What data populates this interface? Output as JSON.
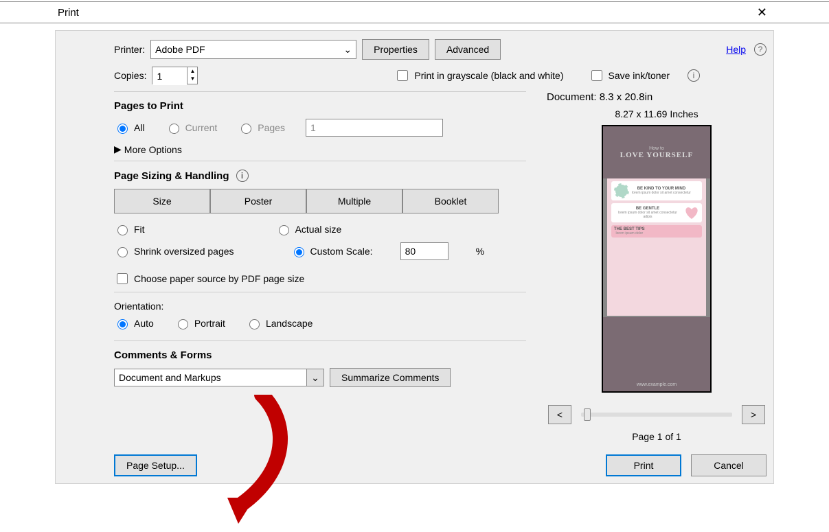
{
  "title": "Print",
  "printer": {
    "label": "Printer:",
    "selected": "Adobe PDF",
    "properties_btn": "Properties",
    "advanced_btn": "Advanced"
  },
  "help_link": "Help",
  "copies": {
    "label": "Copies:",
    "value": "1"
  },
  "grayscale_label": "Print in grayscale (black and white)",
  "saveink_label": "Save ink/toner",
  "pages_to_print": {
    "title": "Pages to Print",
    "all": "All",
    "current": "Current",
    "pages": "Pages",
    "pages_value": "1",
    "more_options": "More Options"
  },
  "sizing": {
    "title": "Page Sizing & Handling",
    "size_btn": "Size",
    "poster_btn": "Poster",
    "multiple_btn": "Multiple",
    "booklet_btn": "Booklet",
    "fit": "Fit",
    "actual": "Actual size",
    "shrink": "Shrink oversized pages",
    "custom_scale": "Custom Scale:",
    "scale_value": "80",
    "percent": "%",
    "choose_source": "Choose paper source by PDF page size"
  },
  "orientation": {
    "title": "Orientation:",
    "auto": "Auto",
    "portrait": "Portrait",
    "landscape": "Landscape"
  },
  "comments": {
    "title": "Comments & Forms",
    "selected": "Document and Markups",
    "summarize_btn": "Summarize Comments"
  },
  "preview": {
    "doc_label": "Document: 8.3 x 20.8in",
    "dim_label": "8.27 x 11.69 Inches",
    "doc_title_small": "How to",
    "doc_title": "LOVE YOURSELF",
    "page_label": "Page 1 of 1",
    "prev": "<",
    "next": ">"
  },
  "footer": {
    "page_setup": "Page Setup...",
    "print_btn": "Print",
    "cancel_btn": "Cancel"
  }
}
